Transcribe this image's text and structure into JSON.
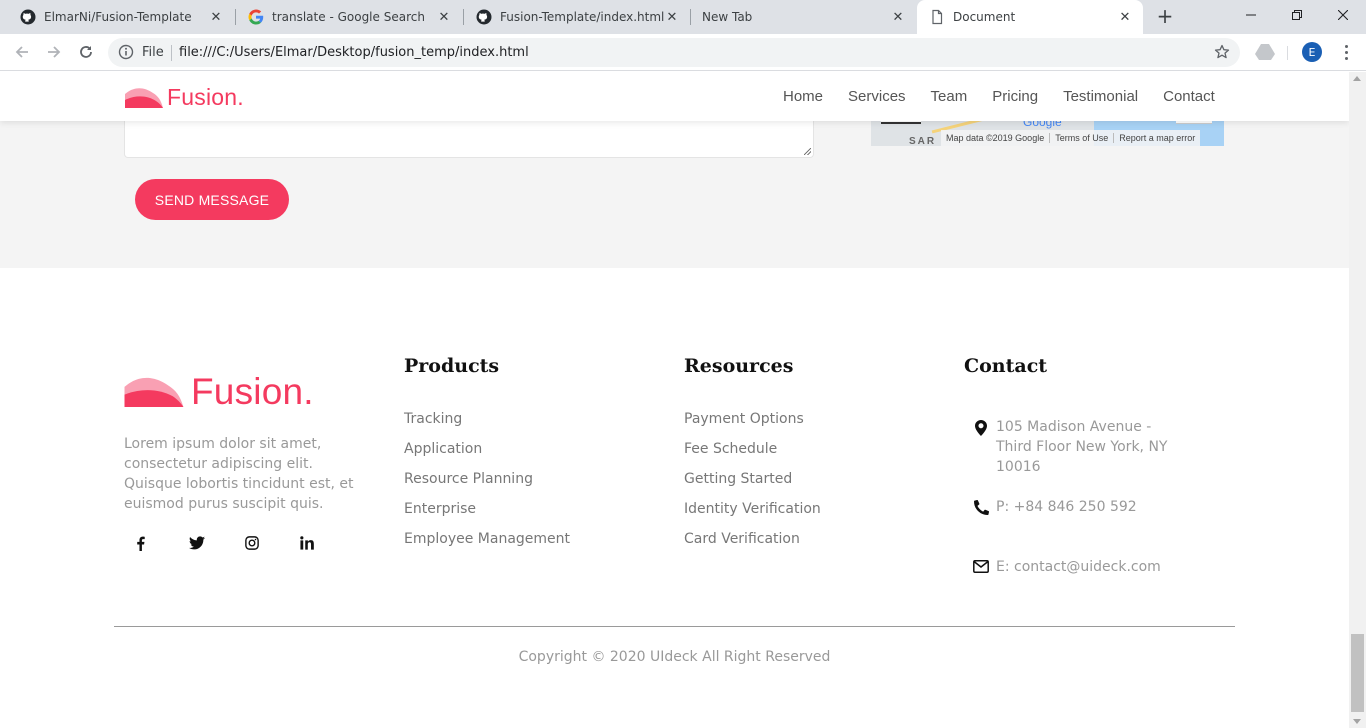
{
  "browser": {
    "tabs": [
      {
        "label": "ElmarNi/Fusion-Template",
        "icon": "github-icon"
      },
      {
        "label": "translate - Google Search",
        "icon": "google-icon"
      },
      {
        "label": "Fusion-Template/index.html at",
        "icon": "github-icon"
      },
      {
        "label": "New Tab",
        "icon": "none"
      },
      {
        "label": "Document",
        "icon": "document-icon",
        "active": true
      }
    ],
    "scheme_label": "File",
    "url": "file:///C:/Users/Elmar/Desktop/fusion_temp/index.html",
    "profile_initial": "E"
  },
  "header": {
    "logo_text": "Fusion.",
    "nav": [
      "Home",
      "Services",
      "Team",
      "Pricing",
      "Testimonial",
      "Contact"
    ]
  },
  "contact_form": {
    "send_label": "SEND MESSAGE"
  },
  "map": {
    "logo_text": "Google",
    "partial_label": "SAR",
    "attribution": [
      "Map data ©2019 Google",
      "Terms of Use",
      "Report a map error"
    ]
  },
  "footer": {
    "logo_text": "Fusion.",
    "description": "Lorem ipsum dolor sit amet, consectetur adipiscing elit. Quisque lobortis tincidunt est, et euismod purus suscipit quis.",
    "social": [
      "facebook-icon",
      "twitter-icon",
      "instagram-icon",
      "linkedin-icon"
    ],
    "products": {
      "title": "Products",
      "items": [
        "Tracking",
        "Application",
        "Resource Planning",
        "Enterprise",
        "Employee Management"
      ]
    },
    "resources": {
      "title": "Resources",
      "items": [
        "Payment Options",
        "Fee Schedule",
        "Getting Started",
        "Identity Verification",
        "Card Verification"
      ]
    },
    "contact": {
      "title": "Contact",
      "address": "105 Madison Avenue - Third Floor New York, NY 10016",
      "phone": "P: +84 846 250 592",
      "email": "E: contact@uideck.com"
    },
    "copyright": "Copyright © 2020 UIdeck All Right Reserved"
  },
  "colors": {
    "brand": "#f43a5f",
    "footer_text": "#999999",
    "band_bg": "#f4f4f4"
  }
}
